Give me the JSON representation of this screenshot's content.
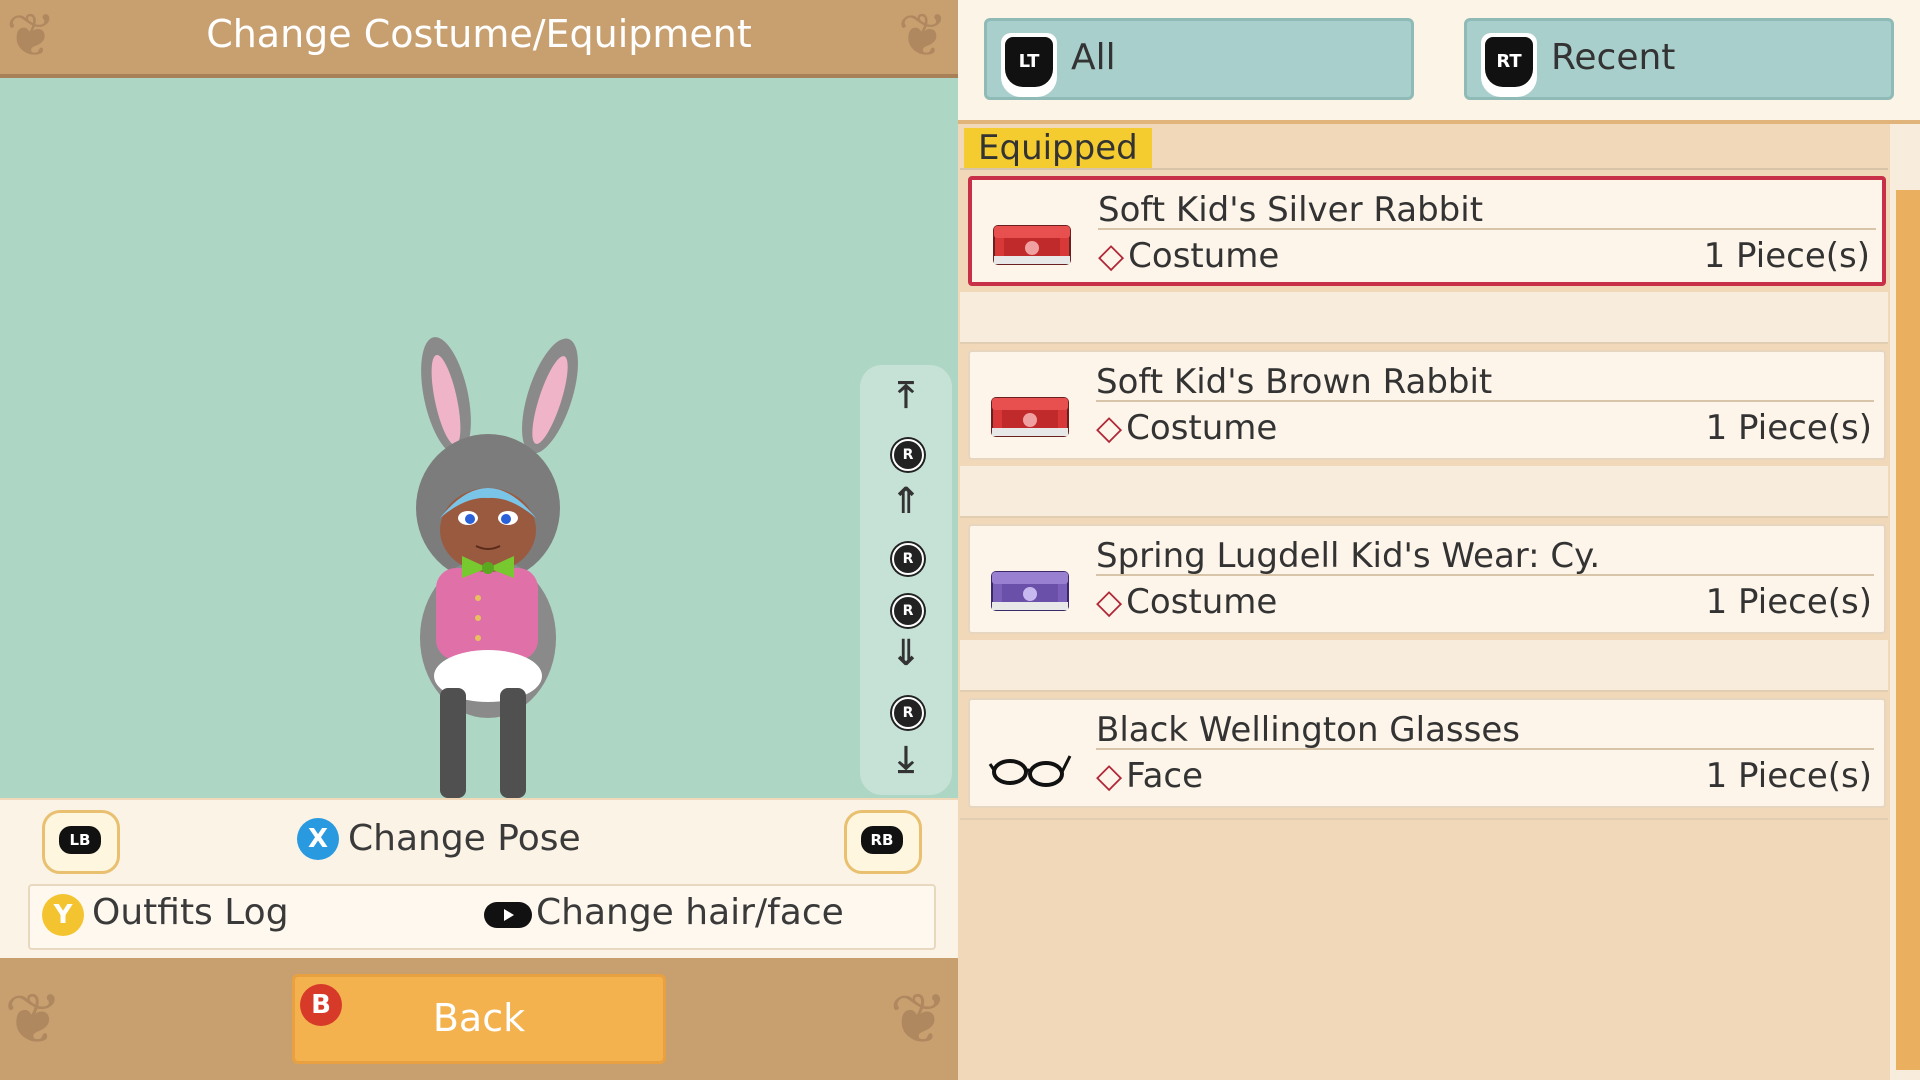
{
  "header": {
    "title": "Change Costume/Equipment"
  },
  "preview": {
    "scroll_controls": [
      "top-icon",
      "rotate-up-icon",
      "zoom-in-icon",
      "rotate-left-icon",
      "rotate-right-icon",
      "zoom-out-icon",
      "rotate-down-icon",
      "bottom-icon"
    ]
  },
  "controls": {
    "lb_label": "LB",
    "rb_label": "RB",
    "x_button": "X",
    "change_pose": "Change Pose",
    "y_button": "Y",
    "outfits_log": "Outfits Log",
    "change_hair_face": "Change hair/face"
  },
  "footer": {
    "b_button": "B",
    "back_label": "Back"
  },
  "tabs": [
    {
      "badge": "LT",
      "label": "All"
    },
    {
      "badge": "RT",
      "label": "Recent"
    }
  ],
  "list": {
    "section_label": "Equipped",
    "items": [
      {
        "name": "Soft Kid's Silver Rabbit",
        "category": "Costume",
        "qty": "1 Piece(s)",
        "icon": "red-costume-case-icon",
        "selected": true
      },
      {
        "name": "Soft Kid's Brown Rabbit",
        "category": "Costume",
        "qty": "1 Piece(s)",
        "icon": "red-costume-case-icon",
        "selected": false
      },
      {
        "name": "Spring Lugdell Kid's Wear: Cy.",
        "category": "Costume",
        "qty": "1 Piece(s)",
        "icon": "purple-costume-case-icon",
        "selected": false
      },
      {
        "name": "Black Wellington Glasses",
        "category": "Face",
        "qty": "1 Piece(s)",
        "icon": "glasses-icon",
        "selected": false
      }
    ]
  },
  "colors": {
    "selected_border": "#c8304a",
    "equipped_tag": "#f4cc30",
    "back_button": "#f3b24e",
    "x_button": "#2a9ae0",
    "y_button": "#f4c430",
    "b_button": "#d83a2a"
  }
}
